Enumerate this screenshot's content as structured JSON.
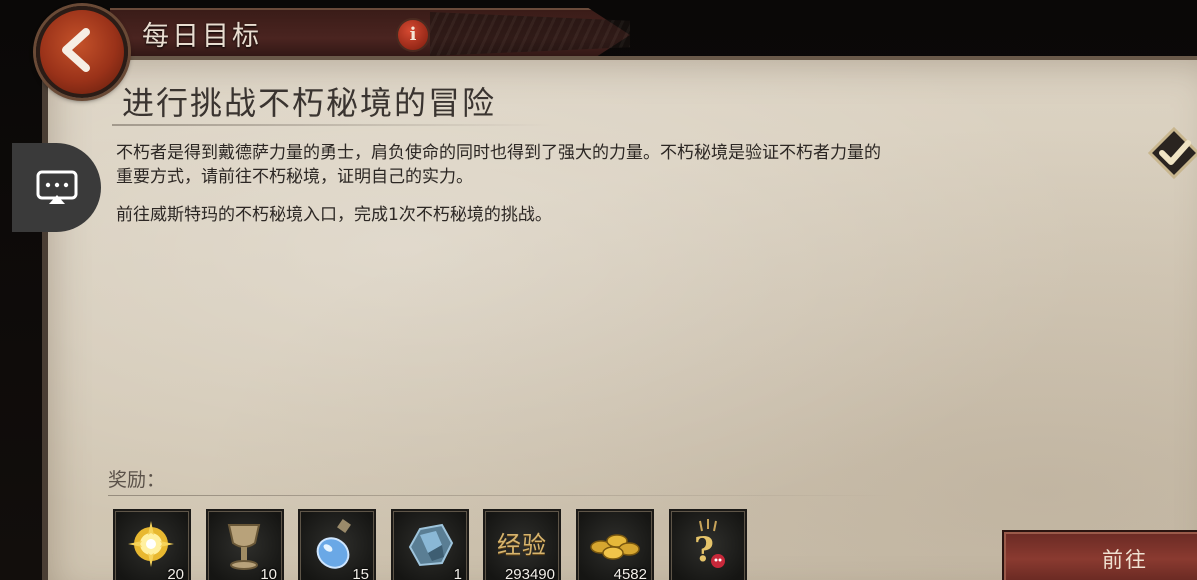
{
  "header": {
    "title": "每日目标",
    "info_label": "i"
  },
  "quest": {
    "title": "进行挑战不朽秘境的冒险",
    "description": "不朽者是得到戴德萨力量的勇士，肩负使命的同时也得到了强大的力量。不朽秘境是验证不朽者力量的重要方式，请前往不朽秘境，证明自己的实力。",
    "objective": "前往威斯特玛的不朽秘境入口，完成1次不朽秘境的挑战。"
  },
  "rewards": {
    "label": "奖励：",
    "items": [
      {
        "icon": "gold-orb-icon",
        "count": "20"
      },
      {
        "icon": "chalice-icon",
        "count": "10"
      },
      {
        "icon": "potion-flask-icon",
        "count": "15"
      },
      {
        "icon": "crystal-ore-icon",
        "count": "1"
      },
      {
        "icon": "experience-icon",
        "label": "经验",
        "count": "293490"
      },
      {
        "icon": "gold-coins-icon",
        "count": "4582"
      },
      {
        "icon": "mystery-item-icon",
        "count": ""
      }
    ]
  },
  "actions": {
    "go_label": "前往"
  }
}
